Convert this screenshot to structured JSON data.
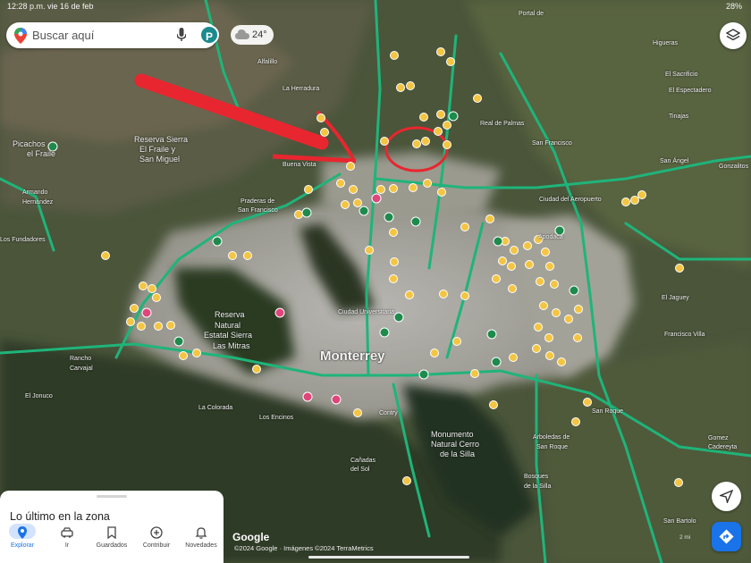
{
  "status_bar": {
    "left": "12:28 p.m.  vie 16 de feb",
    "right": "28%"
  },
  "search": {
    "placeholder": "Buscar aquí",
    "avatar_letter": "P"
  },
  "weather": {
    "temperature": "24°"
  },
  "map_labels": [
    {
      "text": "Monterrey",
      "kind": "city"
    },
    {
      "text": "Picachos",
      "kind": "med"
    },
    {
      "text": "el Fraile",
      "kind": "med"
    },
    {
      "text": "Reserva Sierra",
      "kind": "med"
    },
    {
      "text": "El Fraile y",
      "kind": "med"
    },
    {
      "text": "San Miguel",
      "kind": "med"
    },
    {
      "text": "Reserva",
      "kind": "med"
    },
    {
      "text": "Natural",
      "kind": "med"
    },
    {
      "text": "Estatal Sierra",
      "kind": "med"
    },
    {
      "text": "Las Mitras",
      "kind": "med"
    },
    {
      "text": "Monumento",
      "kind": "med"
    },
    {
      "text": "Natural Cerro",
      "kind": "med"
    },
    {
      "text": "de la Silla",
      "kind": "med"
    },
    {
      "text": "Ciudad Universitaria",
      "kind": "small"
    },
    {
      "text": "Rancho",
      "kind": "small"
    },
    {
      "text": "Carvajal",
      "kind": "small"
    },
    {
      "text": "El Jonuco",
      "kind": "small"
    },
    {
      "text": "La Colorada",
      "kind": "small"
    },
    {
      "text": "Los Encinos",
      "kind": "small"
    },
    {
      "text": "Cañadas",
      "kind": "small"
    },
    {
      "text": "del Sol",
      "kind": "small"
    },
    {
      "text": "Arboledas de",
      "kind": "small"
    },
    {
      "text": "San Roque",
      "kind": "small"
    },
    {
      "text": "San Roque",
      "kind": "small"
    },
    {
      "text": "Bosques",
      "kind": "small"
    },
    {
      "text": "de la Silla",
      "kind": "small"
    },
    {
      "text": "San Bartolo",
      "kind": "small"
    },
    {
      "text": "Francisco Villa",
      "kind": "small"
    },
    {
      "text": "El Jaguey",
      "kind": "small"
    },
    {
      "text": "Buena Vista",
      "kind": "small"
    },
    {
      "text": "La Herradura",
      "kind": "small"
    },
    {
      "text": "Alfalillo",
      "kind": "small"
    },
    {
      "text": "Real de Palmas",
      "kind": "small"
    },
    {
      "text": "San Francisco",
      "kind": "small"
    },
    {
      "text": "Portal de",
      "kind": "small"
    },
    {
      "text": "Higueras",
      "kind": "small"
    },
    {
      "text": "El Sacrificio",
      "kind": "small"
    },
    {
      "text": "El Espectadero",
      "kind": "small"
    },
    {
      "text": "Tinajas",
      "kind": "small"
    },
    {
      "text": "Ciudad del Aeropuerto",
      "kind": "small"
    },
    {
      "text": "Apodaca",
      "kind": "small"
    },
    {
      "text": "Gonzalitos",
      "kind": "small"
    },
    {
      "text": "Praderas de",
      "kind": "small"
    },
    {
      "text": "San Francisco",
      "kind": "small"
    },
    {
      "text": "Armando",
      "kind": "small"
    },
    {
      "text": "Hernández",
      "kind": "small"
    },
    {
      "text": "Los Fundadores",
      "kind": "small"
    },
    {
      "text": "San Ángel",
      "kind": "small"
    },
    {
      "text": "Gomez",
      "kind": "small"
    },
    {
      "text": "Cadereyta",
      "kind": "small"
    },
    {
      "text": "Contry",
      "kind": "small"
    }
  ],
  "bottom_panel": {
    "title": "Lo último en la zona",
    "tabs": [
      {
        "label": "Explorar",
        "icon": "pin-icon",
        "active": true
      },
      {
        "label": "Ir",
        "icon": "car-icon",
        "active": false
      },
      {
        "label": "Guardados",
        "icon": "bookmark-icon",
        "active": false
      },
      {
        "label": "Contribuir",
        "icon": "add-circle-icon",
        "active": false
      },
      {
        "label": "Novedades",
        "icon": "bell-icon",
        "active": false
      }
    ]
  },
  "attribution": {
    "logo": "Google",
    "text": "©2024 Google · Imágenes ©2024 TerraMetrics"
  },
  "scale": "2 mi",
  "colors": {
    "highway": "#1fb47a",
    "poi": "#f4c542",
    "annotation": "#e8262f",
    "brand_blue": "#1a73e8"
  }
}
